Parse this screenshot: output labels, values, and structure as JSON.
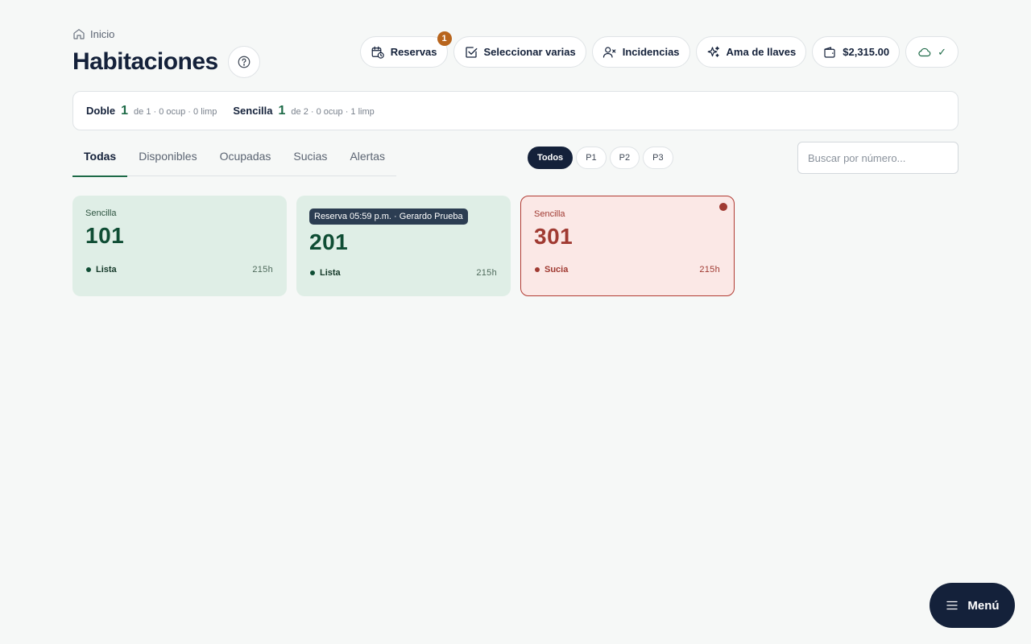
{
  "breadcrumb": {
    "label": "Inicio"
  },
  "page": {
    "title": "Habitaciones"
  },
  "toolbar": {
    "reservas": {
      "label": "Reservas",
      "badge": "1"
    },
    "seleccionar": {
      "label": "Seleccionar varias"
    },
    "incidencias": {
      "label": "Incidencias"
    },
    "ama": {
      "label": "Ama de llaves"
    },
    "balance": {
      "label": "$2,315.00"
    },
    "sync": {
      "label": "✓"
    }
  },
  "summary": [
    {
      "name": "Doble",
      "count": "1",
      "detail": "de 1 · 0 ocup · 0 limp"
    },
    {
      "name": "Sencilla",
      "count": "1",
      "detail": "de 2 · 0 ocup · 1 limp"
    }
  ],
  "tabs": [
    "Todas",
    "Disponibles",
    "Ocupadas",
    "Sucias",
    "Alertas"
  ],
  "active_tab": "Todas",
  "floor_filters": [
    "Todos",
    "P1",
    "P2",
    "P3"
  ],
  "active_floor": "Todos",
  "search": {
    "placeholder": "Buscar por número..."
  },
  "rooms": [
    {
      "type": "Sencilla",
      "number": "101",
      "status": "Lista",
      "hours": "215h",
      "reservation": ""
    },
    {
      "type": "",
      "number": "201",
      "status": "Lista",
      "hours": "215h",
      "reservation": "Reserva 05:59 p.m. · Gerardo Prueba"
    },
    {
      "type": "Sencilla",
      "number": "301",
      "status": "Sucia",
      "hours": "215h",
      "reservation": ""
    }
  ],
  "menu": {
    "label": "Menú"
  },
  "colors": {
    "primary": "#14213a",
    "green": "#1d6a47",
    "ready_bg": "#dfeee6",
    "dirty": "#a03a32",
    "dirty_bg": "#fbe8e6",
    "badge": "#b8651d"
  }
}
